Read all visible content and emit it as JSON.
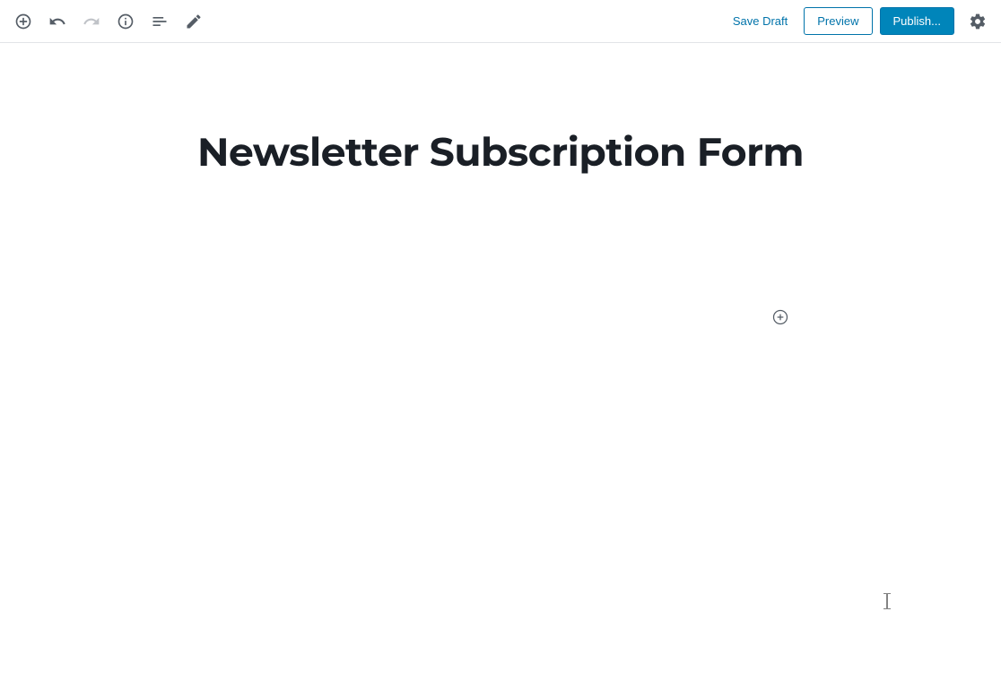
{
  "toolbar": {
    "save_draft_label": "Save Draft",
    "preview_label": "Preview",
    "publish_label": "Publish..."
  },
  "editor": {
    "title": "Newsletter Subscription Form"
  }
}
